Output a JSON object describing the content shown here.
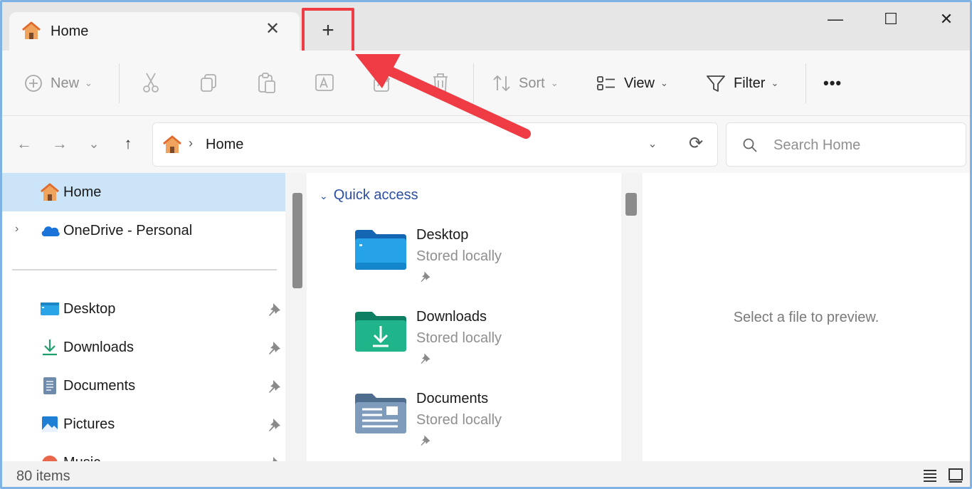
{
  "window": {
    "tab": {
      "title": "Home",
      "icon": "home-icon",
      "close_glyph": "✕"
    },
    "new_tab": {
      "glyph": "+"
    },
    "controls": {
      "minimize": "—",
      "maximize": "☐",
      "close": "✕"
    }
  },
  "toolbar": {
    "new_label": "New",
    "sort_label": "Sort",
    "view_label": "View",
    "filter_label": "Filter",
    "more_glyph": "•••",
    "icons": [
      "cut-icon",
      "copy-icon",
      "paste-icon",
      "rename-icon",
      "share-icon",
      "delete-icon"
    ]
  },
  "navigation": {
    "back": "←",
    "forward": "→",
    "recent": "⌄",
    "up": "↑",
    "address": {
      "separator": "›",
      "text": "Home"
    },
    "dropdown_glyph": "⌄",
    "refresh_glyph": "⟳"
  },
  "search": {
    "placeholder": "Search Home"
  },
  "sidebar": {
    "items": [
      {
        "label": "Home",
        "icon": "home-icon",
        "selected": true
      },
      {
        "label": "OneDrive - Personal",
        "icon": "cloud-icon",
        "expander": "›"
      }
    ],
    "pinned": [
      {
        "label": "Desktop",
        "icon": "desktop-folder-icon"
      },
      {
        "label": "Downloads",
        "icon": "download-icon"
      },
      {
        "label": "Documents",
        "icon": "documents-icon"
      },
      {
        "label": "Pictures",
        "icon": "pictures-icon"
      },
      {
        "label": "Music",
        "icon": "music-icon"
      }
    ]
  },
  "quick_access": {
    "header": "Quick access",
    "items": [
      {
        "name": "Desktop",
        "status": "Stored locally",
        "icon": "desktop-folder-icon"
      },
      {
        "name": "Downloads",
        "status": "Stored locally",
        "icon": "downloads-folder-icon"
      },
      {
        "name": "Documents",
        "status": "Stored locally",
        "icon": "documents-folder-icon"
      }
    ]
  },
  "preview": {
    "text": "Select a file to preview."
  },
  "status": {
    "count": "80 items"
  },
  "colors": {
    "accent": "#0067c0",
    "selection": "#cce4f7",
    "annotation": "#ef3b44",
    "link": "#2b4fa3"
  }
}
